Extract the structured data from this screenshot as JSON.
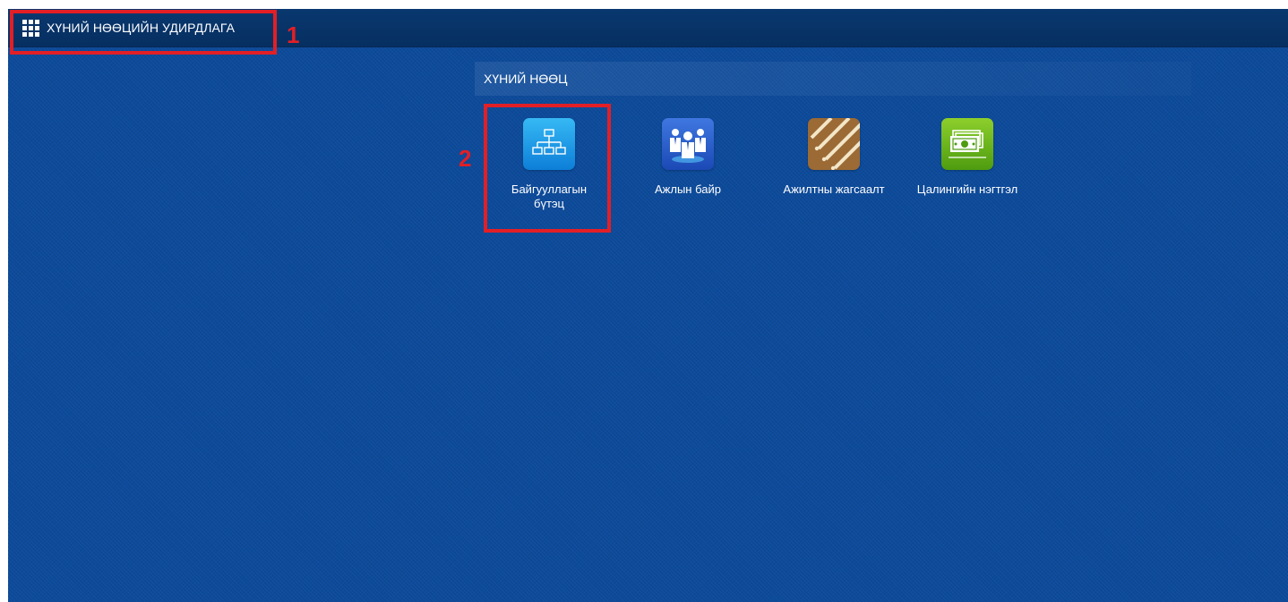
{
  "header": {
    "app_title": "ХҮНИЙ НӨӨЦИЙН УДИРДЛАГА",
    "menu_icon": "apps-grid-icon"
  },
  "section": {
    "title": "ХҮНИЙ НӨӨЦ"
  },
  "tiles": [
    {
      "label_line1": "Байгууллагын",
      "label_line2": "бүтэц",
      "icon": "org-structure-icon",
      "color": "#1a93e6"
    },
    {
      "label_line1": "Ажлын байр",
      "label_line2": "",
      "icon": "job-positions-icon",
      "color": "#2c5fcf"
    },
    {
      "label_line1": "Ажилтны жагсаалт",
      "label_line2": "",
      "icon": "employee-list-icon",
      "color": "#9b6a35"
    },
    {
      "label_line1": "Цалингийн нэгтгэл",
      "label_line2": "",
      "icon": "payroll-icon",
      "color": "#6ab51e"
    }
  ],
  "annotations": [
    {
      "label": "1",
      "color": "#e21f26"
    },
    {
      "label": "2",
      "color": "#e21f26"
    }
  ],
  "colors": {
    "background": "#0c4a9a",
    "topbar": "#072f61",
    "annotation": "#e21f26"
  }
}
